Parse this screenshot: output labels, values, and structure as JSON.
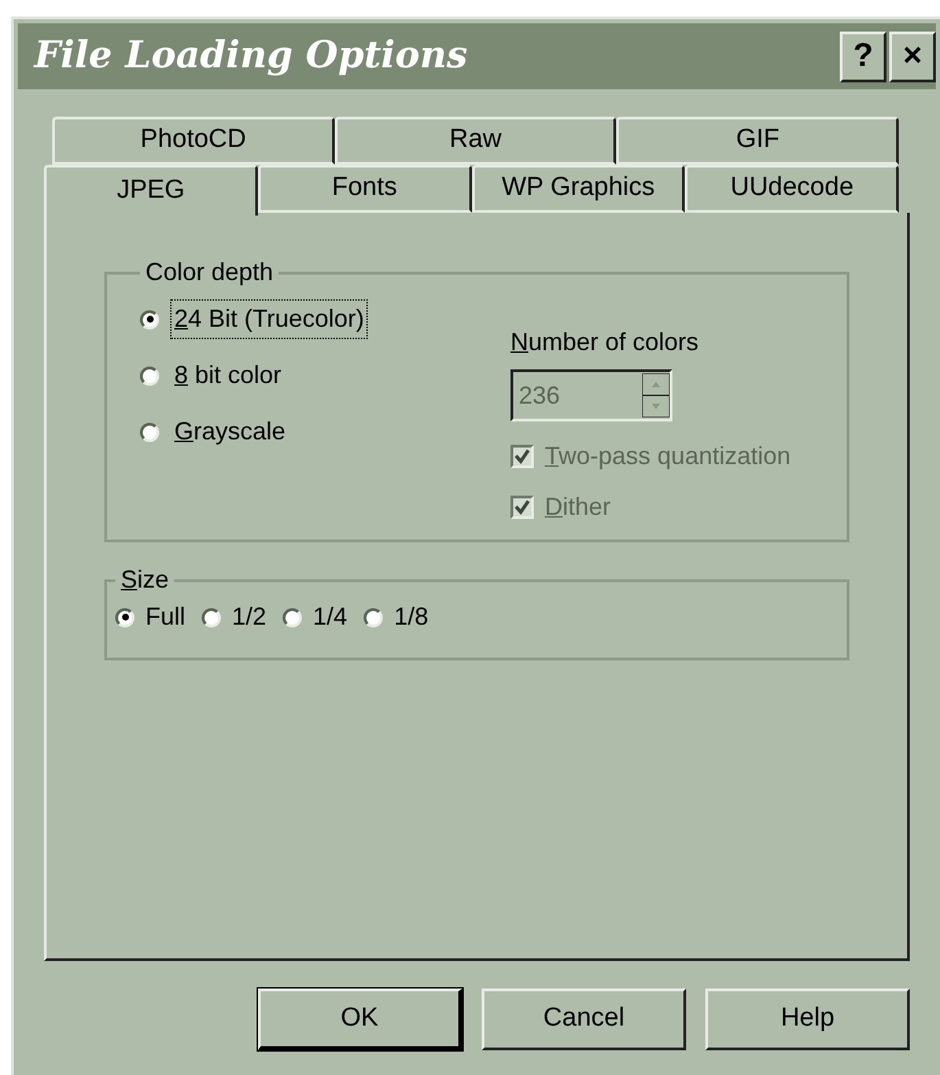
{
  "window": {
    "title": "File Loading Options",
    "title_buttons": [
      "?",
      "×"
    ]
  },
  "tab_rows": [
    [
      {
        "label": "PhotoCD",
        "selected": false
      },
      {
        "label": "Raw",
        "selected": false
      },
      {
        "label": "GIF",
        "selected": false
      }
    ],
    [
      {
        "label": "JPEG",
        "selected": true
      },
      {
        "label": "Fonts",
        "selected": false
      },
      {
        "label": "WP Graphics",
        "selected": false
      },
      {
        "label": "UUdecode",
        "selected": false
      }
    ]
  ],
  "color_depth": {
    "legend": "Color depth",
    "options": [
      {
        "label": "24 Bit (Truecolor)",
        "underlined_key": true,
        "selected": true,
        "focused": true
      },
      {
        "label": "8 bit color",
        "underlined_key": true,
        "selected": false,
        "focused": false
      },
      {
        "label": "Grayscale",
        "underlined_key": true,
        "selected": false,
        "focused": false
      }
    ],
    "number_of_colors": {
      "label": "Number of colors",
      "underlined_key": true,
      "value": "236",
      "disabled": true
    },
    "checkboxes": [
      {
        "label": "Two-pass quantization",
        "underlined_key": true,
        "checked": true,
        "disabled": true
      },
      {
        "label": "Dither",
        "underlined_key": true,
        "checked": true,
        "disabled": true
      }
    ]
  },
  "size": {
    "legend": "Size",
    "underlined_key": true,
    "options": [
      {
        "label": "Full",
        "selected": true
      },
      {
        "label": "1/2",
        "selected": false
      },
      {
        "label": "1/4",
        "selected": false
      },
      {
        "label": "1/8",
        "selected": false
      }
    ]
  },
  "buttons": [
    {
      "label": "OK",
      "default": true
    },
    {
      "label": "Cancel",
      "default": false
    },
    {
      "label": "Help",
      "default": false
    }
  ]
}
